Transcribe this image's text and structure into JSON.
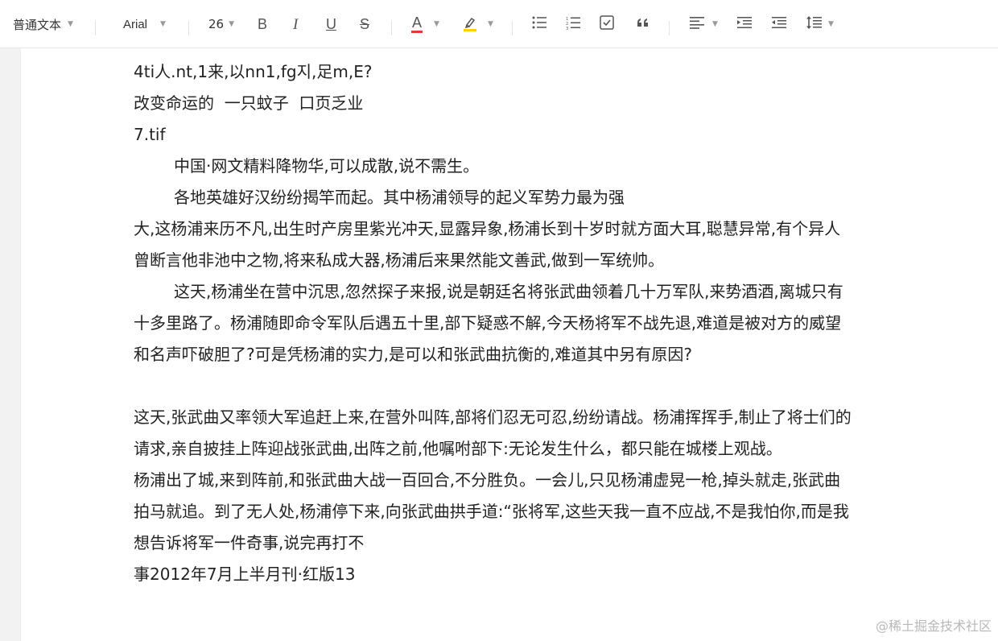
{
  "toolbar": {
    "paragraph_style": "普通文本",
    "font_family": "Arial",
    "font_size": "26",
    "bold": "B",
    "italic": "I",
    "underline": "U",
    "strike": "S",
    "font_color": "A",
    "font_color_accent": "#e53935",
    "highlight_accent": "#f5d400"
  },
  "document": {
    "lines": [
      "4ti人.nt,1来,以nn1,fg지,足m,E?",
      "改变命运的  一只蚊子  口页乏业",
      "7.tif",
      "中国·网文精料降物华,可以成散,说不需生。",
      "各地英雄好汉纷纷揭竿而起。其中杨浦领导的起义军势力最为强",
      "大,这杨浦来历不凡,出生时产房里紫光冲天,显露异象,杨浦长到十岁时就方面大耳,聪慧异常,有个异人",
      "曾断言他非池中之物,将来私成大器,杨浦后来果然能文善武,做到一军统帅。",
      "这天,杨浦坐在营中沉思,忽然探子来报,说是朝廷名将张武曲领着几十万军队,来势酒酒,离城只有",
      "十多里路了。杨浦随即命令军队后遇五十里,部下疑惑不解,今天杨将军不战先退,难道是被对方的威望",
      "和名声吓破胆了?可是凭杨浦的实力,是可以和张武曲抗衡的,难道其中另有原因?",
      "",
      "这天,张武曲又率领大军追赶上来,在营外叫阵,部将们忍无可忍,纷纷请战。杨浦挥挥手,制止了将士们的",
      "请求,亲自披挂上阵迎战张武曲,出阵之前,他嘱咐部下:无论发生什么，都只能在城楼上观战。",
      "杨浦出了城,来到阵前,和张武曲大战一百回合,不分胜负。一会儿,只见杨浦虚晃一枪,掉头就走,张武曲",
      "拍马就追。到了无人处,杨浦停下来,向张武曲拱手道:“张将军,这些天我一直不应战,不是我怕你,而是我",
      "想告诉将军一件奇事,说完再打不",
      "事2012年7月上半月刊·红版13"
    ]
  },
  "watermark": "@稀土掘金技术社区"
}
